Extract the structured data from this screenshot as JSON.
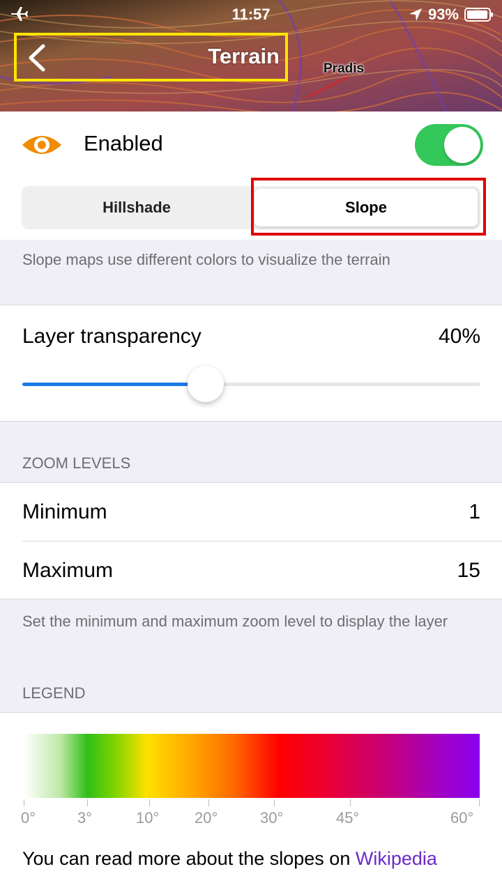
{
  "status_bar": {
    "time": "11:57",
    "battery": "93%",
    "icons": [
      "airplane-icon",
      "location-arrow-icon",
      "battery-icon"
    ]
  },
  "header": {
    "title": "Terrain",
    "map_label": "Pradis",
    "highlight_color": "#ffe400"
  },
  "layer": {
    "enabled_label": "Enabled",
    "enabled": true,
    "eye_icon_color": "#f08c00",
    "toggle_color": "#34c759"
  },
  "segments": {
    "items": [
      "Hillshade",
      "Slope"
    ],
    "selected": "Slope",
    "highlight_color": "#e00000"
  },
  "slope_description": "Slope maps use different colors to visualize the terrain",
  "transparency": {
    "label": "Layer transparency",
    "value": "40%",
    "fraction": 0.4
  },
  "zoom": {
    "header": "ZOOM LEVELS",
    "minimum_label": "Minimum",
    "minimum_value": "1",
    "maximum_label": "Maximum",
    "maximum_value": "15",
    "description": "Set the minimum and maximum zoom level to display the layer"
  },
  "legend": {
    "header": "LEGEND",
    "ticks": [
      "0°",
      "3°",
      "10°",
      "20°",
      "30°",
      "45°",
      "60°"
    ],
    "footer_text": "You can read more about the slopes on ",
    "footer_link": "Wikipedia"
  }
}
